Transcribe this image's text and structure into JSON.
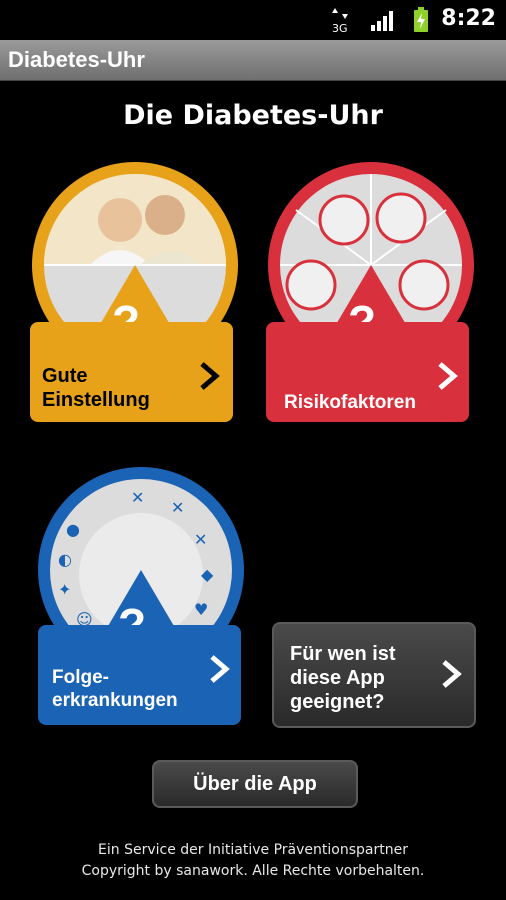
{
  "status": {
    "network": "3G",
    "time": "8:22"
  },
  "appbar": {
    "title": "Diabetes-Uhr"
  },
  "main": {
    "heading": "Die Diabetes-Uhr"
  },
  "tiles": {
    "gute": {
      "line1": "Gute",
      "line2": "Einstellung",
      "color": "#e8a21a"
    },
    "risiko": {
      "line1": "Risikofaktoren",
      "color": "#d8303c"
    },
    "folge": {
      "line1": "Folge-",
      "line2": "erkrankungen",
      "color": "#1b63b4"
    }
  },
  "buttons": {
    "fuer_wen": {
      "line1": "Für wen ist",
      "line2": "diese App",
      "line3": "geeignet?"
    },
    "ueber": {
      "label": "Über die App"
    }
  },
  "footer": {
    "line1": "Ein Service der Initiative Präventionspartner",
    "line2": "Copyright by sanawork. Alle Rechte vorbehalten."
  },
  "icons": [
    "network-3g-icon",
    "signal-icon",
    "battery-icon",
    "question-icon",
    "chevron-right-icon"
  ]
}
